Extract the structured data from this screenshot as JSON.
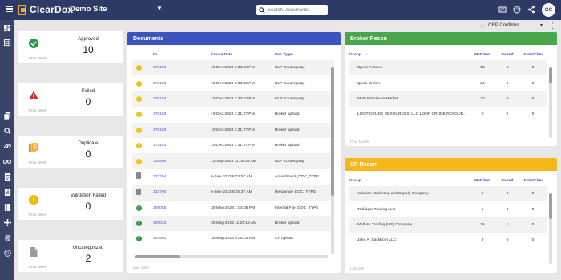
{
  "app": {
    "name": "ClearDox",
    "site": "Demo Site",
    "user_initials": "GC"
  },
  "search": {
    "placeholder": "Search Documents"
  },
  "header_icons": [
    "news-icon",
    "help-icon",
    "share-icon"
  ],
  "sidebar_icons": [
    "dashboard-icon",
    "grid-icon",
    "documents-icon",
    "search-icon",
    "link-icon",
    "infinity-icon",
    "form-icon",
    "reports-icon",
    "book-icon",
    "network-icon",
    "settings-icon",
    "help-icon"
  ],
  "selector": {
    "value": "CRP Confirms"
  },
  "stats": [
    {
      "label": "Approved",
      "value": "10",
      "foot": "Prior Week",
      "icon": "approved-icon"
    },
    {
      "label": "Failed",
      "value": "0",
      "foot": "Prior Week",
      "icon": "failed-icon"
    },
    {
      "label": "Duplicate",
      "value": "0",
      "foot": "Prior Week",
      "icon": "duplicate-icon"
    },
    {
      "label": "Validation Failed",
      "value": "0",
      "foot": "Prior Week",
      "icon": "validation-failed-icon"
    },
    {
      "label": "Uncategorized",
      "value": "2",
      "foot": "Prior Week",
      "icon": "uncategorized-icon"
    }
  ],
  "documents": {
    "title": "Documents",
    "columns": [
      "ID",
      "Create Date",
      "Doc Type"
    ],
    "footer": "Last 1000",
    "rows": [
      {
        "status": "pending",
        "id": "378186",
        "date": "10-Dec-2023 1:33:34 PM",
        "type": "NLP Couterparty"
      },
      {
        "status": "pending",
        "id": "378185",
        "date": "10-Dec-2023 1:33:33 PM",
        "type": "NLP Couterparty"
      },
      {
        "status": "pending",
        "id": "378184",
        "date": "10-Dec-2023 1:33:33 PM",
        "type": "NLP Couterparty"
      },
      {
        "status": "pending",
        "id": "378183",
        "date": "10-Dec-2023 1:31:27 PM",
        "type": "Broker upload"
      },
      {
        "status": "pending",
        "id": "378182",
        "date": "10-Dec-2023 1:31:27 PM",
        "type": "Broker upload"
      },
      {
        "status": "pending",
        "id": "378181",
        "date": "10-Dec-2023 1:31:27 PM",
        "type": "Broker upload"
      },
      {
        "status": "pending",
        "id": "334866",
        "date": "13-Sep-2023 11:04:38 AM",
        "type": "NLP Couterparty"
      },
      {
        "status": "file",
        "id": "331794",
        "date": "6-Sep-2023 8:42:57 AM",
        "type": "Amendment_DOC_TYPE"
      },
      {
        "status": "file",
        "id": "331790",
        "date": "6-Sep-2023 8:40:37 AM",
        "type": "Response_DOC_TYPE"
      },
      {
        "status": "ok",
        "id": "305055",
        "date": "30-May-2023 1:04:05 PM",
        "type": "Internal File_DOC_TYPE"
      },
      {
        "status": "ok",
        "id": "305023",
        "date": "30-May-2023 11:29:16 AM",
        "type": "Broker upload"
      },
      {
        "status": "ok",
        "id": "304982",
        "date": "30-May-2023 9:35:02 AM",
        "type": "CP upload"
      }
    ]
  },
  "broker_recon": {
    "title": "Broker Recon",
    "columns": [
      "Group",
      "Matched",
      "Paired",
      "Unmatched"
    ],
    "footer": "Prior Month",
    "rows": [
      {
        "group": "Spear Futures",
        "matched": "18",
        "paired": "0",
        "unmatched": "0"
      },
      {
        "group": "Quick Broker",
        "matched": "24",
        "paired": "0",
        "unmatched": "0"
      },
      {
        "group": "MVP Petroleum Market",
        "matched": "32",
        "paired": "0",
        "unmatched": "0"
      },
      {
        "group": "LOOP CRUDE RESOURCES, LLC LOOP CRUDE RESOUR...",
        "matched": "0",
        "paired": "0",
        "unmatched": "0"
      }
    ]
  },
  "cp_recon": {
    "title": "CP Recon",
    "columns": [
      "Group",
      "Matched",
      "Paired",
      "Unmatched"
    ],
    "footer": "Last 100",
    "rows": [
      {
        "group": "Valerian Marketing and Supply Company",
        "matched": "2",
        "paired": "0",
        "unmatched": "0"
      },
      {
        "group": "Trafalgar Trading LLC",
        "matched": "1",
        "paired": "0",
        "unmatched": "0"
      },
      {
        "group": "Mollusk Trading (US) Company",
        "matched": "26",
        "paired": "1",
        "unmatched": "0"
      },
      {
        "group": "Jake A. Sackhorn LLC",
        "matched": "8",
        "paired": "0",
        "unmatched": "0"
      }
    ]
  }
}
